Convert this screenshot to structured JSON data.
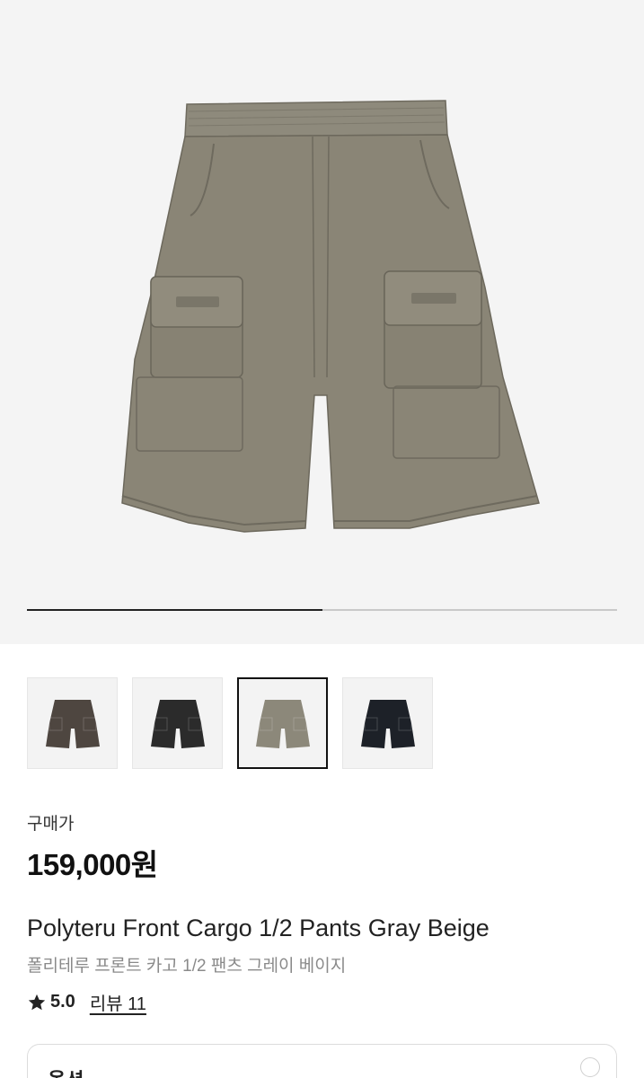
{
  "gallery": {
    "progress": 0.5,
    "colors": {
      "progress_track": "#c9c9c9",
      "progress_fill": "#222222",
      "hero_bg": "#f4f4f4",
      "pants": "#8a8576"
    },
    "thumbnails": [
      {
        "name": "brown",
        "color": "#4e4640",
        "selected": false
      },
      {
        "name": "black",
        "color": "#2b2b2b",
        "selected": false
      },
      {
        "name": "gray-beige",
        "color": "#8c887a",
        "selected": true
      },
      {
        "name": "navy",
        "color": "#1d2128",
        "selected": false
      }
    ]
  },
  "product": {
    "price_label": "구매가",
    "price": "159,000원",
    "name_en": "Polyteru Front Cargo 1/2 Pants Gray Beige",
    "name_ko": "폴리테루 프론트 카고 1/2 팬츠 그레이 베이지",
    "rating": "5.0",
    "review_link": "리뷰 11"
  },
  "option": {
    "label": "옵션"
  }
}
